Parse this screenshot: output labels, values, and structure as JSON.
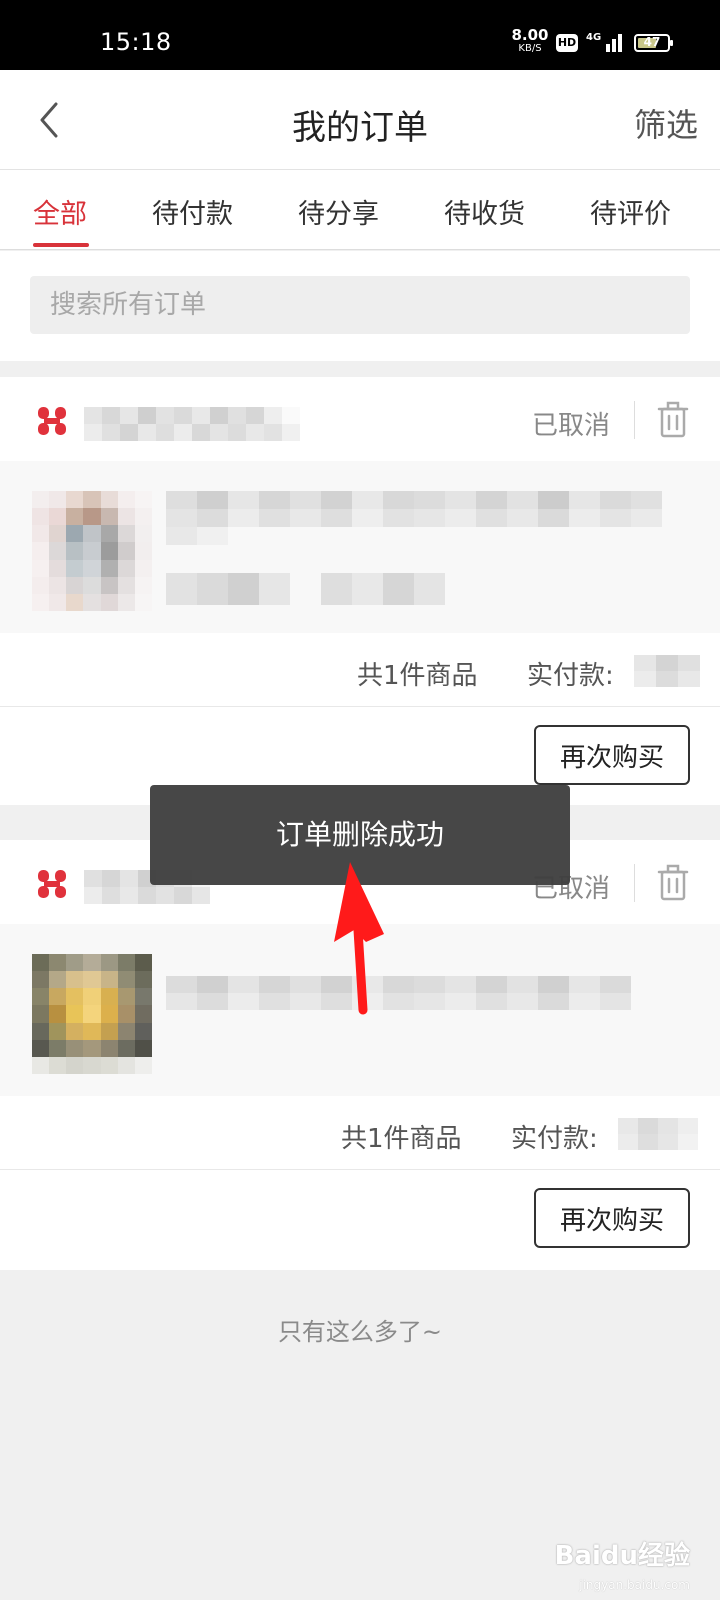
{
  "status_bar": {
    "time": "15:18",
    "net_speed": "8.00",
    "net_speed_unit": "KB/S",
    "hd_badge": "HD",
    "network": "4G",
    "battery": "47"
  },
  "header": {
    "title": "我的订单",
    "filter_label": "筛选"
  },
  "tabs": [
    {
      "label": "全部",
      "active": true
    },
    {
      "label": "待付款",
      "active": false
    },
    {
      "label": "待分享",
      "active": false
    },
    {
      "label": "待收货",
      "active": false
    },
    {
      "label": "待评价",
      "active": false
    }
  ],
  "search": {
    "placeholder": "搜索所有订单"
  },
  "orders": [
    {
      "status": "已取消",
      "item_count": "共1件商品",
      "paid_label": "实付款:",
      "rebuy_label": "再次购买"
    },
    {
      "status": "已取消",
      "item_count": "共1件商品",
      "paid_label": "实付款:",
      "rebuy_label": "再次购买"
    }
  ],
  "footer": {
    "end_text": "只有这么多了~"
  },
  "toast": {
    "message": "订单删除成功"
  },
  "watermark": {
    "text": "Baidu经验",
    "sub": "jingyan.baidu.com"
  },
  "colors": {
    "accent": "#d8333a",
    "toast_bg": "#404040",
    "arrow": "#ff0000"
  }
}
